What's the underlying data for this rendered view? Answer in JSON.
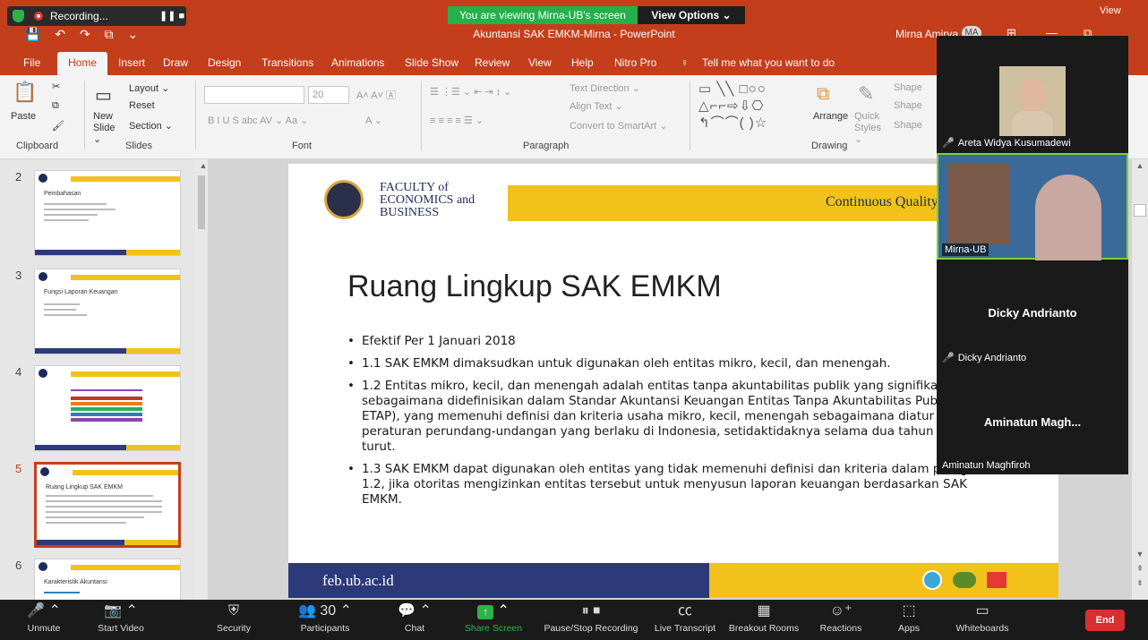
{
  "zoom": {
    "recording_label": "Recording...",
    "recording_controls": "❚❚ ■",
    "viewing_banner": "You are viewing Mirna-UB's screen",
    "view_options": "View Options ⌄",
    "view_top": "View",
    "toolbar": [
      {
        "label": "Unmute",
        "icon": "microphone-muted-icon",
        "glyph": "🎤"
      },
      {
        "label": "Start Video",
        "icon": "video-off-icon",
        "glyph": "📷"
      },
      {
        "label": "Security",
        "icon": "shield-icon",
        "glyph": "⛨"
      },
      {
        "label": "Participants",
        "icon": "participants-icon",
        "glyph": "👥 30"
      },
      {
        "label": "Chat",
        "icon": "chat-icon",
        "glyph": "💬"
      },
      {
        "label": "Share Screen",
        "icon": "share-screen-icon",
        "glyph": "↑"
      },
      {
        "label": "Pause/Stop Recording",
        "icon": "pause-stop-icon",
        "glyph": "❚❚ ■"
      },
      {
        "label": "Live Transcript",
        "icon": "cc-icon",
        "glyph": "CC"
      },
      {
        "label": "Breakout Rooms",
        "icon": "breakout-rooms-icon",
        "glyph": "▦"
      },
      {
        "label": "Reactions",
        "icon": "reactions-icon",
        "glyph": "☺"
      },
      {
        "label": "Apps",
        "icon": "apps-icon",
        "glyph": "⬚"
      },
      {
        "label": "Whiteboards",
        "icon": "whiteboard-icon",
        "glyph": "▭"
      }
    ],
    "end_label": "End",
    "participants": [
      {
        "name": "Areta Widya Kusumadewi",
        "muted": true
      },
      {
        "name": "Mirna-UB",
        "muted": false
      },
      {
        "name": "Dicky Andrianto",
        "display": "Dicky Andrianto",
        "muted": true
      },
      {
        "name": "Aminatun Maghfiroh",
        "display": "Aminatun Magh...",
        "muted": false
      }
    ]
  },
  "window": {
    "title": "Akuntansi SAK EMKM-Mirna  -  PowerPoint",
    "user": "Mirna Amirya",
    "avatar_initials": "MA"
  },
  "ribbon": {
    "tabs": [
      "File",
      "Home",
      "Insert",
      "Draw",
      "Design",
      "Transitions",
      "Animations",
      "Slide Show",
      "Review",
      "View",
      "Help",
      "Nitro Pro"
    ],
    "active_tab": "Home",
    "tell_me": "Tell me what you want to do",
    "clipboard": {
      "paste": "Paste",
      "group": "Clipboard"
    },
    "slides": {
      "new_slide": "New Slide ⌄",
      "layout": "Layout ⌄",
      "reset": "Reset",
      "section": "Section ⌄",
      "group": "Slides"
    },
    "font": {
      "size": "20",
      "group": "Font",
      "format_row": "B   I   U   S   abc   AV ⌄   Aa ⌄"
    },
    "paragraph": {
      "text_direction": "Text Direction ⌄",
      "align_text": "Align Text ⌄",
      "smartart": "Convert to SmartArt ⌄",
      "group": "Paragraph"
    },
    "drawing": {
      "arrange": "Arrange",
      "quick_styles": "Quick Styles ⌄",
      "shape_fill": "Shape",
      "shape_outline": "Shape",
      "shape_effects": "Shape",
      "group": "Drawing"
    }
  },
  "thumbnails": [
    {
      "number": "2",
      "title": "Pembahasan"
    },
    {
      "number": "3",
      "title": "Fungsi Laporan Keuangan"
    },
    {
      "number": "4",
      "title": ""
    },
    {
      "number": "5",
      "title": "Ruang Lingkup SAK EMKM"
    },
    {
      "number": "6",
      "title": "Karakteristik Akuntansi"
    }
  ],
  "slide": {
    "faculty_line1": "FACULTY of",
    "faculty_line2": "ECONOMICS and",
    "faculty_line3": "BUSINESS",
    "tagline": "Continuous Quality",
    "heading": "Ruang Lingkup SAK EMKM",
    "bullets": [
      "Efektif Per 1 Januari 2018",
      "1.1 SAK EMKM dimaksudkan untuk digunakan oleh entitas mikro, kecil, dan menengah.",
      "1.2 Entitas mikro, kecil, dan menengah adalah entitas tanpa akuntabilitas publik yang signifikan, sebagaimana didefinisikan dalam Standar Akuntansi Keuangan Entitas Tanpa Akuntabilitas Publik (SAK ETAP), yang memenuhi definisi dan kriteria usaha mikro, kecil, menengah sebagaimana diatur dalam peraturan perundang-undangan yang berlaku di Indonesia, setidaktidaknya selama dua tahun berturut-turut.",
      "1.3 SAK EMKM dapat digunakan oleh entitas yang tidak memenuhi definisi dan kriteria dalam paragraf 1.2, jika otoritas mengizinkan entitas tersebut untuk menyusun laporan keuangan berdasarkan SAK EMKM."
    ],
    "footer_site": "feb.ub.ac.id"
  }
}
